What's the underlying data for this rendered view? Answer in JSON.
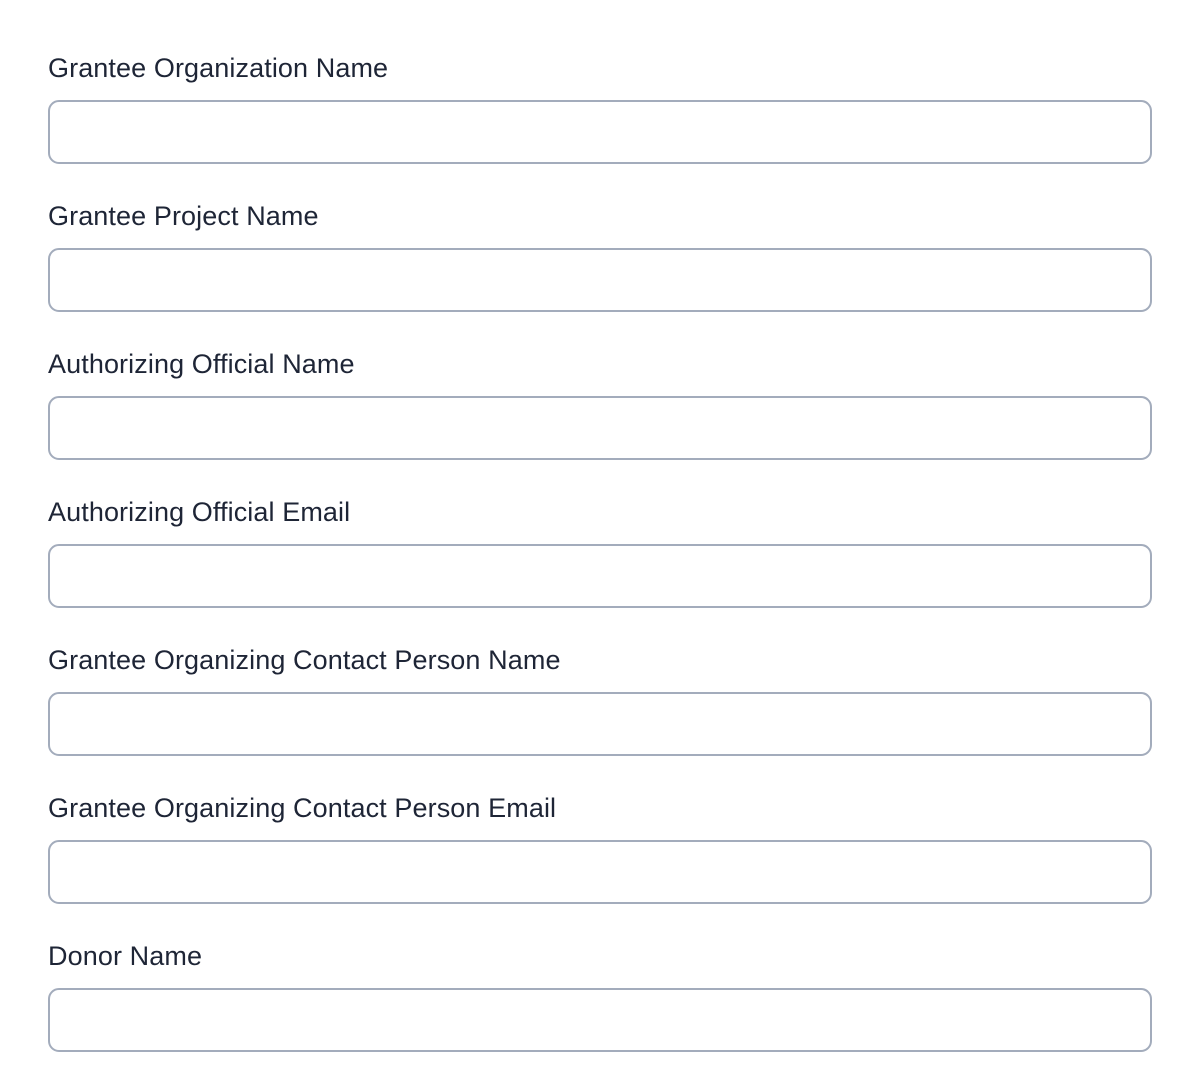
{
  "form": {
    "fields": [
      {
        "label": "Grantee Organization Name",
        "value": "",
        "placeholder": ""
      },
      {
        "label": "Grantee Project Name",
        "value": "",
        "placeholder": ""
      },
      {
        "label": "Authorizing Official Name",
        "value": "",
        "placeholder": ""
      },
      {
        "label": "Authorizing Official Email",
        "value": "",
        "placeholder": ""
      },
      {
        "label": "Grantee Organizing Contact Person Name",
        "value": "",
        "placeholder": ""
      },
      {
        "label": "Grantee Organizing Contact Person Email",
        "value": "",
        "placeholder": ""
      },
      {
        "label": "Donor Name",
        "value": "",
        "placeholder": ""
      }
    ]
  },
  "colors": {
    "label_text": "#1e2536",
    "input_border": "#a3acbc",
    "background": "#ffffff"
  }
}
